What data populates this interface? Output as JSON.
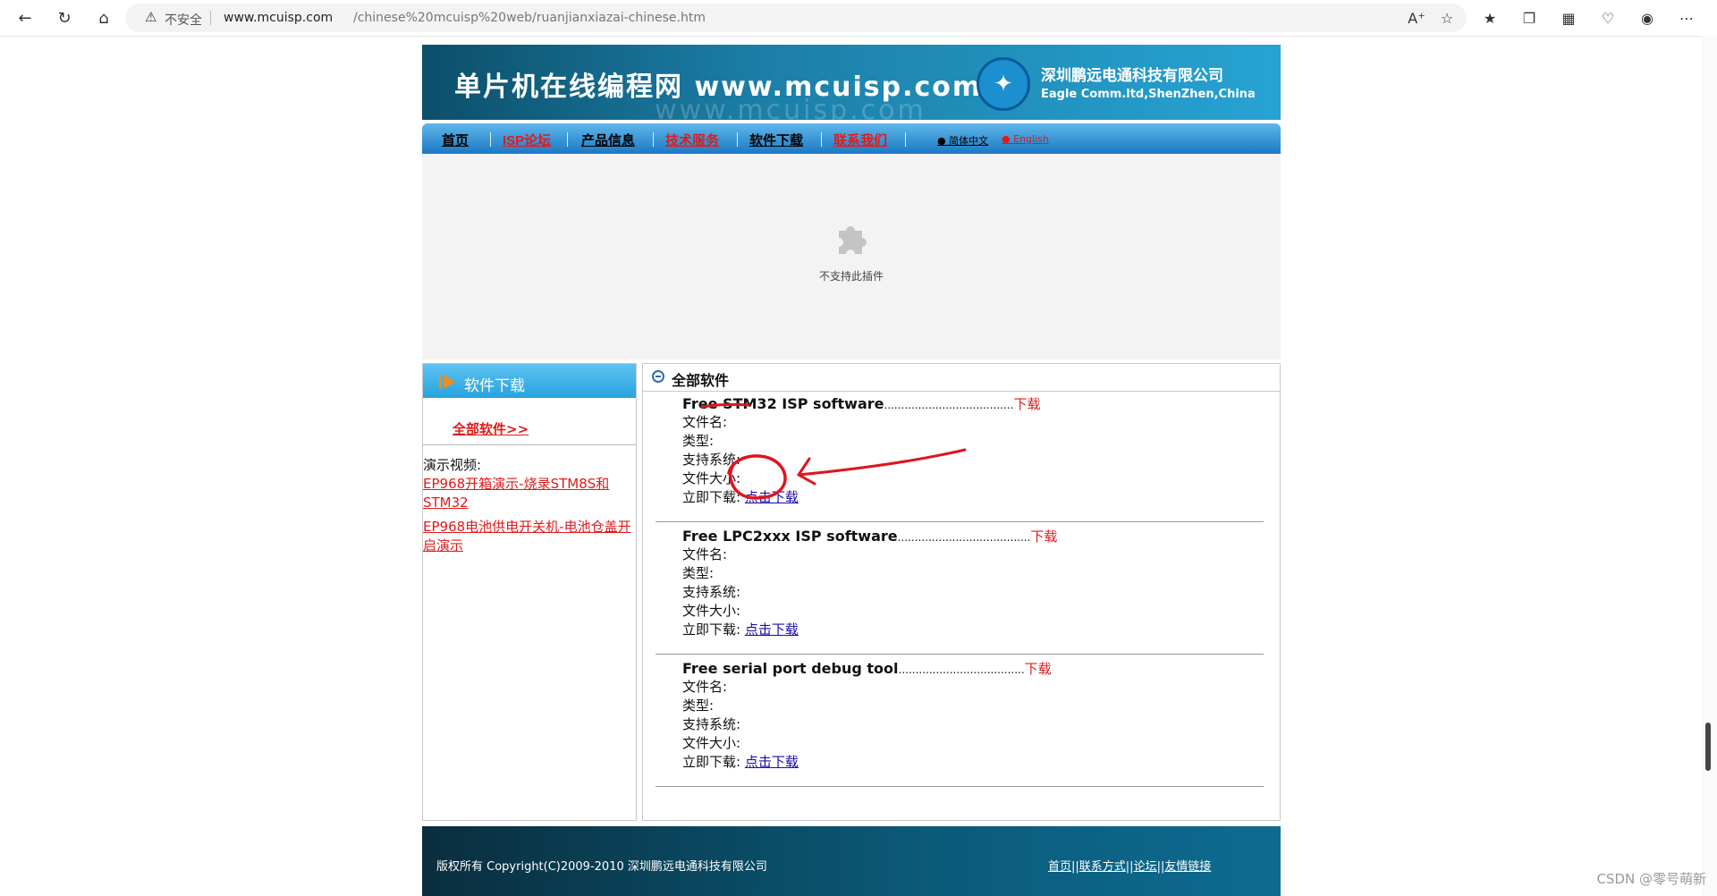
{
  "browser": {
    "warning_text": "不安全",
    "url_host": "www.mcuisp.com",
    "url_path": "/chinese%20mcuisp%20web/ruanjianxiazai-chinese.htm"
  },
  "banner": {
    "title": "单片机在线编程网 www.mcuisp.com",
    "company_cn": "深圳鹏远电通科技有限公司",
    "company_en": "Eagle Comm.ltd,ShenZhen,China"
  },
  "nav": {
    "items": [
      {
        "label": "首页",
        "color": "#000000"
      },
      {
        "label": "ISP论坛",
        "color": "#e21a1a"
      },
      {
        "label": "产品信息",
        "color": "#000000"
      },
      {
        "label": "技术服务",
        "color": "#e21a1a"
      },
      {
        "label": "软件下载",
        "color": "#000000"
      },
      {
        "label": "联系我们",
        "color": "#e21a1a"
      }
    ],
    "lang_cn": "● 简体中文",
    "lang_en": "● English"
  },
  "plugin": {
    "message": "不支持此插件"
  },
  "sidebar": {
    "header": "软件下载",
    "all_link": "全部软件>>",
    "video_label": "演示视频:",
    "links": [
      "EP968开箱演示-烧录STM8S和STM32",
      "EP968电池供电开关机-电池仓盖开启演示"
    ]
  },
  "main": {
    "header": "全部软件",
    "entries": [
      {
        "title": "Free STM32 ISP software",
        "dots": "......................................",
        "download": "下载",
        "file_name": "文件名:",
        "type": "类型:",
        "os": "支持系统:",
        "size": "文件大小:",
        "download_now": "立即下载:",
        "click_download": "点击下载"
      },
      {
        "title": "Free LPC2xxx ISP software",
        "dots": ".......................................",
        "download": "下载",
        "file_name": "文件名:",
        "type": "类型:",
        "os": "支持系统:",
        "size": "文件大小:",
        "download_now": "立即下载:",
        "click_download": "点击下载"
      },
      {
        "title": "Free serial port debug tool",
        "dots": ".....................................",
        "download": "下载",
        "file_name": "文件名:",
        "type": "类型:",
        "os": "支持系统:",
        "size": "文件大小:",
        "download_now": "立即下载:",
        "click_download": "点击下载"
      }
    ]
  },
  "footer": {
    "copyright": "版权所有 Copyright(C)2009-2010 深圳鹏远电通科技有限公司",
    "links": [
      "首页",
      "联系方式",
      "论坛",
      "友情链接"
    ]
  },
  "watermark": "CSDN @零号萌新",
  "colors": {
    "accent_red": "#e21a1a",
    "link_blue": "#1a0dab",
    "annotation_red": "#e0141e"
  }
}
